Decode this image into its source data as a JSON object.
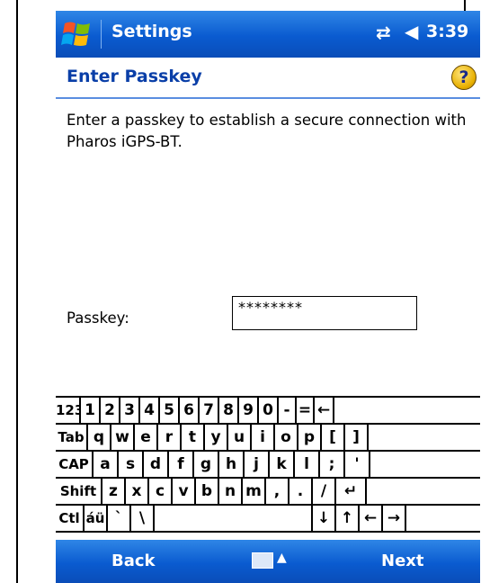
{
  "titlebar": {
    "app_title": "Settings",
    "time": "3:39",
    "windows_icon": "windows-start-icon",
    "connectivity_icon": "connectivity-arrows-icon",
    "volume_icon": "speaker-icon"
  },
  "header": {
    "title": "Enter Passkey",
    "help_icon": "help-question-icon"
  },
  "content": {
    "description": "Enter a passkey to establish a secure connection with Pharos iGPS-BT.",
    "passkey_label": "Passkey:",
    "passkey_value": "********"
  },
  "keyboard": {
    "rows": [
      [
        {
          "label": "123",
          "w": 28,
          "small": true
        },
        {
          "label": "1",
          "w": 22
        },
        {
          "label": "2",
          "w": 22
        },
        {
          "label": "3",
          "w": 22
        },
        {
          "label": "4",
          "w": 22
        },
        {
          "label": "5",
          "w": 22
        },
        {
          "label": "6",
          "w": 22
        },
        {
          "label": "7",
          "w": 22
        },
        {
          "label": "8",
          "w": 22
        },
        {
          "label": "9",
          "w": 22
        },
        {
          "label": "0",
          "w": 22
        },
        {
          "label": "-",
          "w": 20
        },
        {
          "label": "=",
          "w": 20
        },
        {
          "label": "←",
          "w": 22
        }
      ],
      [
        {
          "label": "Tab",
          "w": 36,
          "small": true
        },
        {
          "label": "q",
          "w": 26
        },
        {
          "label": "w",
          "w": 26
        },
        {
          "label": "e",
          "w": 26
        },
        {
          "label": "r",
          "w": 26
        },
        {
          "label": "t",
          "w": 26
        },
        {
          "label": "y",
          "w": 26
        },
        {
          "label": "u",
          "w": 26
        },
        {
          "label": "i",
          "w": 26
        },
        {
          "label": "o",
          "w": 26
        },
        {
          "label": "p",
          "w": 26
        },
        {
          "label": "[",
          "w": 26
        },
        {
          "label": "]",
          "w": 26
        }
      ],
      [
        {
          "label": "CAP",
          "w": 42,
          "small": true
        },
        {
          "label": "a",
          "w": 28
        },
        {
          "label": "s",
          "w": 28
        },
        {
          "label": "d",
          "w": 28
        },
        {
          "label": "f",
          "w": 28
        },
        {
          "label": "g",
          "w": 28
        },
        {
          "label": "h",
          "w": 28
        },
        {
          "label": "j",
          "w": 28
        },
        {
          "label": "k",
          "w": 28
        },
        {
          "label": "l",
          "w": 28
        },
        {
          "label": ";",
          "w": 28
        },
        {
          "label": "'",
          "w": 28
        }
      ],
      [
        {
          "label": "Shift",
          "w": 52,
          "small": true
        },
        {
          "label": "z",
          "w": 26
        },
        {
          "label": "x",
          "w": 26
        },
        {
          "label": "c",
          "w": 26
        },
        {
          "label": "v",
          "w": 26
        },
        {
          "label": "b",
          "w": 26
        },
        {
          "label": "n",
          "w": 26
        },
        {
          "label": "m",
          "w": 26
        },
        {
          "label": ",",
          "w": 26
        },
        {
          "label": ".",
          "w": 26
        },
        {
          "label": "/",
          "w": 26
        },
        {
          "label": "↵",
          "w": 34
        }
      ],
      [
        {
          "label": "Ctl",
          "w": 32,
          "small": true
        },
        {
          "label": "áü",
          "w": 26,
          "small": true
        },
        {
          "label": "`",
          "w": 26
        },
        {
          "label": "\\",
          "w": 26
        },
        {
          "label": " ",
          "w": 176
        },
        {
          "label": "↓",
          "w": 26
        },
        {
          "label": "↑",
          "w": 26
        },
        {
          "label": "←",
          "w": 26
        },
        {
          "label": "→",
          "w": 26
        }
      ]
    ]
  },
  "bottombar": {
    "left_soft_key": "Back",
    "right_soft_key": "Next",
    "input_icon": "keyboard-icon",
    "input_arrow": "▲"
  },
  "colors": {
    "bar_blue": "#0a5bd0",
    "title_text": "#0a3fa8"
  }
}
